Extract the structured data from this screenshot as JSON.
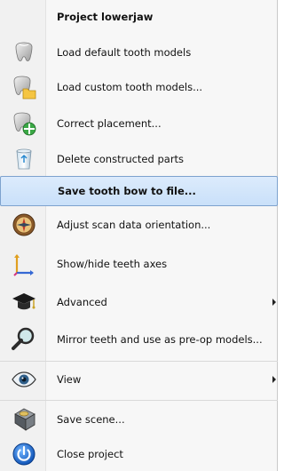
{
  "menu": {
    "title": "Project lowerjaw",
    "items": [
      {
        "label": "Load default tooth models",
        "icon": "tooth-icon"
      },
      {
        "label": "Load custom tooth models...",
        "icon": "tooth-folder-icon"
      },
      {
        "label": "Correct placement...",
        "icon": "tooth-move-icon"
      },
      {
        "label": "Delete constructed parts",
        "icon": "recycle-bin-icon"
      },
      {
        "label": "Save tooth bow to file...",
        "icon": "none",
        "highlighted": true
      },
      {
        "label": "Adjust scan data orientation...",
        "icon": "compass-icon"
      },
      {
        "label": "Show/hide teeth axes",
        "icon": "axes-icon"
      },
      {
        "label": "Advanced",
        "icon": "graduation-cap-icon",
        "has_submenu": true
      },
      {
        "label": "Mirror teeth and use as pre-op models...",
        "icon": "magnifier-icon"
      },
      {
        "label": "View",
        "icon": "eye-icon",
        "has_submenu": true
      },
      {
        "label": "Save scene...",
        "icon": "hard-disk-icon"
      },
      {
        "label": "Close project",
        "icon": "power-icon"
      }
    ]
  }
}
